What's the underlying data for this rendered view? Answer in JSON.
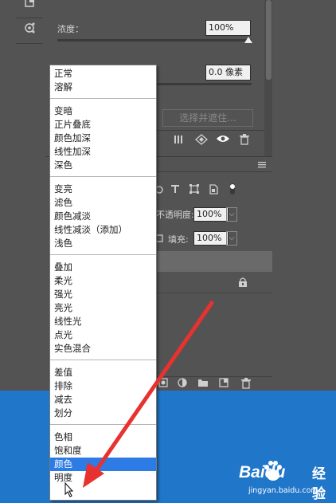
{
  "properties": {
    "density_label": "浓度：",
    "density_value": "100%",
    "feather_value": "0.0 像素",
    "select_mask_button": "选择并遮住..."
  },
  "layers": {
    "opacity_label": "不透明度:",
    "opacity_value": "100%",
    "fill_label": "填充:",
    "fill_value": "100%"
  },
  "blend_menu": {
    "groups": [
      [
        "正常",
        "溶解"
      ],
      [
        "变暗",
        "正片叠底",
        "颜色加深",
        "线性加深",
        "深色"
      ],
      [
        "变亮",
        "滤色",
        "颜色减淡",
        "线性减淡（添加）",
        "浅色"
      ],
      [
        "叠加",
        "柔光",
        "强光",
        "亮光",
        "线性光",
        "点光",
        "实色混合"
      ],
      [
        "差值",
        "排除",
        "减去",
        "划分"
      ],
      [
        "色相",
        "饱和度",
        "颜色",
        "明度"
      ]
    ],
    "selected": "颜色"
  },
  "watermark": {
    "logo": "Baidu",
    "cn": "经验",
    "url": "jingyan.baidu.com"
  },
  "colors": {
    "panel_bg": "#535353",
    "menu_selected": "#2d7be5",
    "desktop_blue": "#2076c9",
    "arrow_red": "#e8322f"
  },
  "icons": [
    "tool-icon",
    "content-aware-icon",
    "type-icon",
    "transform-icon",
    "smartobject-icon",
    "toggle-icon",
    "mask-icon",
    "visibility-icon",
    "trash-icon",
    "lock-icon",
    "adjustment-icon",
    "folder-icon",
    "new-layer-icon",
    "panel-menu-icon"
  ]
}
